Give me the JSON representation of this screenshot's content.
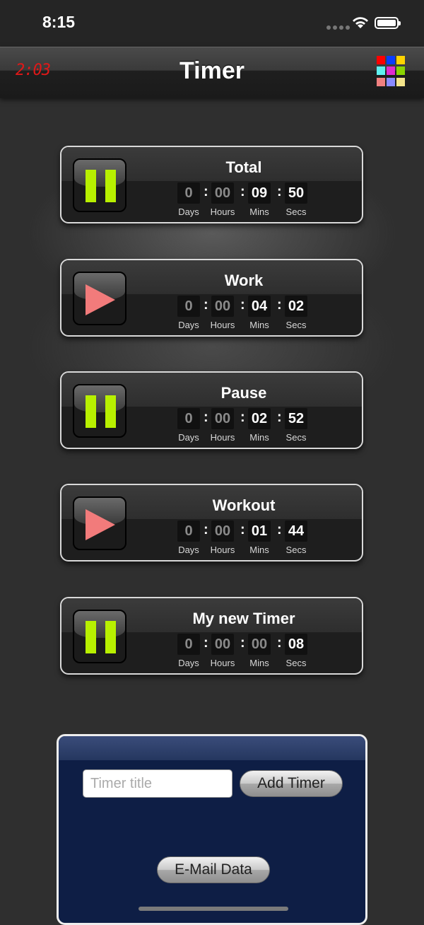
{
  "status_bar": {
    "time": "8:15"
  },
  "nav": {
    "clock": "2:03",
    "title": "Timer",
    "grid_colors": [
      "#ff0000",
      "#0a3cff",
      "#ffd400",
      "#5ef0f0",
      "#e02ad0",
      "#8ad400",
      "#f08080",
      "#8a8aff",
      "#f4e48a"
    ]
  },
  "units": {
    "days": "Days",
    "hours": "Hours",
    "mins": "Mins",
    "secs": "Secs"
  },
  "timers": [
    {
      "title": "Total",
      "state": "running",
      "days": "0",
      "hours": "00",
      "mins": "09",
      "secs": "50"
    },
    {
      "title": "Work",
      "state": "paused",
      "days": "0",
      "hours": "00",
      "mins": "04",
      "secs": "02"
    },
    {
      "title": "Pause",
      "state": "running",
      "days": "0",
      "hours": "00",
      "mins": "02",
      "secs": "52"
    },
    {
      "title": "Workout",
      "state": "paused",
      "days": "0",
      "hours": "00",
      "mins": "01",
      "secs": "44"
    },
    {
      "title": "My new Timer",
      "state": "running",
      "days": "0",
      "hours": "00",
      "mins": "00",
      "secs": "08"
    }
  ],
  "panel": {
    "input_placeholder": "Timer title",
    "input_value": "",
    "add_label": "Add Timer",
    "email_label": "E-Mail Data"
  },
  "colors": {
    "pause_green": "#b8f000",
    "play_red": "#f27b7b",
    "panel_blue": "#0e1e45"
  }
}
